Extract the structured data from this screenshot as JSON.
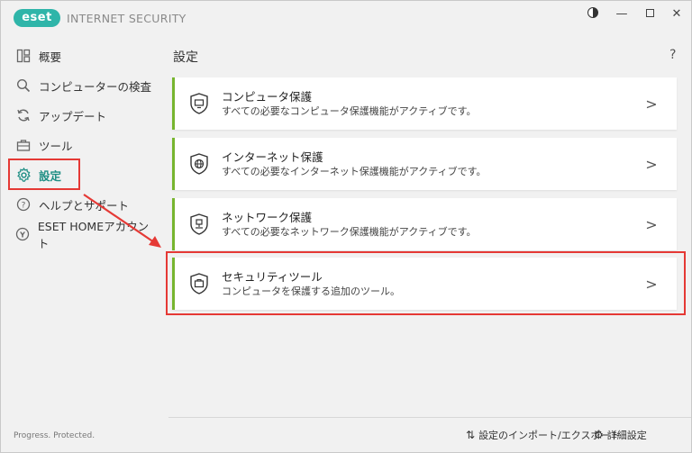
{
  "app": {
    "logo_text": "eset",
    "title": "INTERNET SECURITY"
  },
  "sidebar": {
    "items": [
      {
        "label": "概要",
        "icon": "overview-icon"
      },
      {
        "label": "コンピューターの検査",
        "icon": "search-icon"
      },
      {
        "label": "アップデート",
        "icon": "refresh-icon"
      },
      {
        "label": "ツール",
        "icon": "toolbox-icon"
      },
      {
        "label": "設定",
        "icon": "gear-icon"
      },
      {
        "label": "ヘルプとサポート",
        "icon": "help-icon"
      },
      {
        "label": "ESET HOMEアカウント",
        "icon": "eset-home-icon"
      }
    ],
    "status": "Progress. Protected."
  },
  "main": {
    "title": "設定",
    "help": "?",
    "cards": [
      {
        "title": "コンピュータ保護",
        "desc": "すべての必要なコンピュータ保護機能がアクティブです。",
        "icon": "monitor-shield-icon"
      },
      {
        "title": "インターネット保護",
        "desc": "すべての必要なインターネット保護機能がアクティブです。",
        "icon": "globe-shield-icon"
      },
      {
        "title": "ネットワーク保護",
        "desc": "すべての必要なネットワーク保護機能がアクティブです。",
        "icon": "network-shield-icon"
      },
      {
        "title": "セキュリティツール",
        "desc": "コンピュータを保護する追加のツール。",
        "icon": "briefcase-shield-icon"
      }
    ],
    "bottom": {
      "import_export": "設定のインポート/エクスポート",
      "advanced": "詳細設定"
    }
  },
  "colors": {
    "accent": "#1e8e84",
    "card_border": "#77b52f",
    "highlight": "#e53935"
  }
}
